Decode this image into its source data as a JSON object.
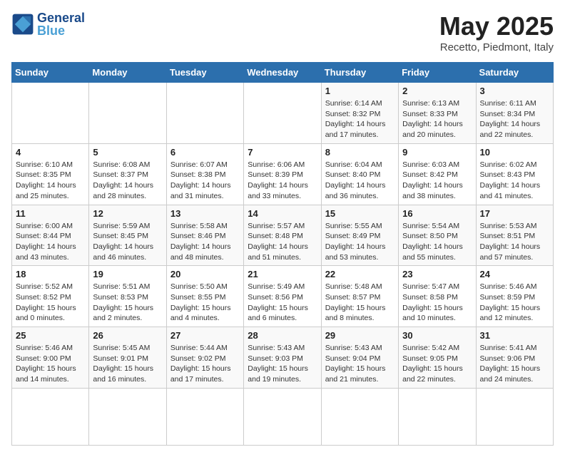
{
  "logo": {
    "line1": "General",
    "line2": "Blue"
  },
  "title": "May 2025",
  "subtitle": "Recetto, Piedmont, Italy",
  "weekdays": [
    "Sunday",
    "Monday",
    "Tuesday",
    "Wednesday",
    "Thursday",
    "Friday",
    "Saturday"
  ],
  "days": [
    {
      "num": "",
      "info": ""
    },
    {
      "num": "",
      "info": ""
    },
    {
      "num": "",
      "info": ""
    },
    {
      "num": "",
      "info": ""
    },
    {
      "num": "1",
      "info": "Sunrise: 6:14 AM\nSunset: 8:32 PM\nDaylight: 14 hours\nand 17 minutes."
    },
    {
      "num": "2",
      "info": "Sunrise: 6:13 AM\nSunset: 8:33 PM\nDaylight: 14 hours\nand 20 minutes."
    },
    {
      "num": "3",
      "info": "Sunrise: 6:11 AM\nSunset: 8:34 PM\nDaylight: 14 hours\nand 22 minutes."
    },
    {
      "num": "4",
      "info": "Sunrise: 6:10 AM\nSunset: 8:35 PM\nDaylight: 14 hours\nand 25 minutes."
    },
    {
      "num": "5",
      "info": "Sunrise: 6:08 AM\nSunset: 8:37 PM\nDaylight: 14 hours\nand 28 minutes."
    },
    {
      "num": "6",
      "info": "Sunrise: 6:07 AM\nSunset: 8:38 PM\nDaylight: 14 hours\nand 31 minutes."
    },
    {
      "num": "7",
      "info": "Sunrise: 6:06 AM\nSunset: 8:39 PM\nDaylight: 14 hours\nand 33 minutes."
    },
    {
      "num": "8",
      "info": "Sunrise: 6:04 AM\nSunset: 8:40 PM\nDaylight: 14 hours\nand 36 minutes."
    },
    {
      "num": "9",
      "info": "Sunrise: 6:03 AM\nSunset: 8:42 PM\nDaylight: 14 hours\nand 38 minutes."
    },
    {
      "num": "10",
      "info": "Sunrise: 6:02 AM\nSunset: 8:43 PM\nDaylight: 14 hours\nand 41 minutes."
    },
    {
      "num": "11",
      "info": "Sunrise: 6:00 AM\nSunset: 8:44 PM\nDaylight: 14 hours\nand 43 minutes."
    },
    {
      "num": "12",
      "info": "Sunrise: 5:59 AM\nSunset: 8:45 PM\nDaylight: 14 hours\nand 46 minutes."
    },
    {
      "num": "13",
      "info": "Sunrise: 5:58 AM\nSunset: 8:46 PM\nDaylight: 14 hours\nand 48 minutes."
    },
    {
      "num": "14",
      "info": "Sunrise: 5:57 AM\nSunset: 8:48 PM\nDaylight: 14 hours\nand 51 minutes."
    },
    {
      "num": "15",
      "info": "Sunrise: 5:55 AM\nSunset: 8:49 PM\nDaylight: 14 hours\nand 53 minutes."
    },
    {
      "num": "16",
      "info": "Sunrise: 5:54 AM\nSunset: 8:50 PM\nDaylight: 14 hours\nand 55 minutes."
    },
    {
      "num": "17",
      "info": "Sunrise: 5:53 AM\nSunset: 8:51 PM\nDaylight: 14 hours\nand 57 minutes."
    },
    {
      "num": "18",
      "info": "Sunrise: 5:52 AM\nSunset: 8:52 PM\nDaylight: 15 hours\nand 0 minutes."
    },
    {
      "num": "19",
      "info": "Sunrise: 5:51 AM\nSunset: 8:53 PM\nDaylight: 15 hours\nand 2 minutes."
    },
    {
      "num": "20",
      "info": "Sunrise: 5:50 AM\nSunset: 8:55 PM\nDaylight: 15 hours\nand 4 minutes."
    },
    {
      "num": "21",
      "info": "Sunrise: 5:49 AM\nSunset: 8:56 PM\nDaylight: 15 hours\nand 6 minutes."
    },
    {
      "num": "22",
      "info": "Sunrise: 5:48 AM\nSunset: 8:57 PM\nDaylight: 15 hours\nand 8 minutes."
    },
    {
      "num": "23",
      "info": "Sunrise: 5:47 AM\nSunset: 8:58 PM\nDaylight: 15 hours\nand 10 minutes."
    },
    {
      "num": "24",
      "info": "Sunrise: 5:46 AM\nSunset: 8:59 PM\nDaylight: 15 hours\nand 12 minutes."
    },
    {
      "num": "25",
      "info": "Sunrise: 5:46 AM\nSunset: 9:00 PM\nDaylight: 15 hours\nand 14 minutes."
    },
    {
      "num": "26",
      "info": "Sunrise: 5:45 AM\nSunset: 9:01 PM\nDaylight: 15 hours\nand 16 minutes."
    },
    {
      "num": "27",
      "info": "Sunrise: 5:44 AM\nSunset: 9:02 PM\nDaylight: 15 hours\nand 17 minutes."
    },
    {
      "num": "28",
      "info": "Sunrise: 5:43 AM\nSunset: 9:03 PM\nDaylight: 15 hours\nand 19 minutes."
    },
    {
      "num": "29",
      "info": "Sunrise: 5:43 AM\nSunset: 9:04 PM\nDaylight: 15 hours\nand 21 minutes."
    },
    {
      "num": "30",
      "info": "Sunrise: 5:42 AM\nSunset: 9:05 PM\nDaylight: 15 hours\nand 22 minutes."
    },
    {
      "num": "31",
      "info": "Sunrise: 5:41 AM\nSunset: 9:06 PM\nDaylight: 15 hours\nand 24 minutes."
    },
    {
      "num": "",
      "info": ""
    },
    {
      "num": "",
      "info": ""
    },
    {
      "num": "",
      "info": ""
    },
    {
      "num": "",
      "info": ""
    }
  ]
}
